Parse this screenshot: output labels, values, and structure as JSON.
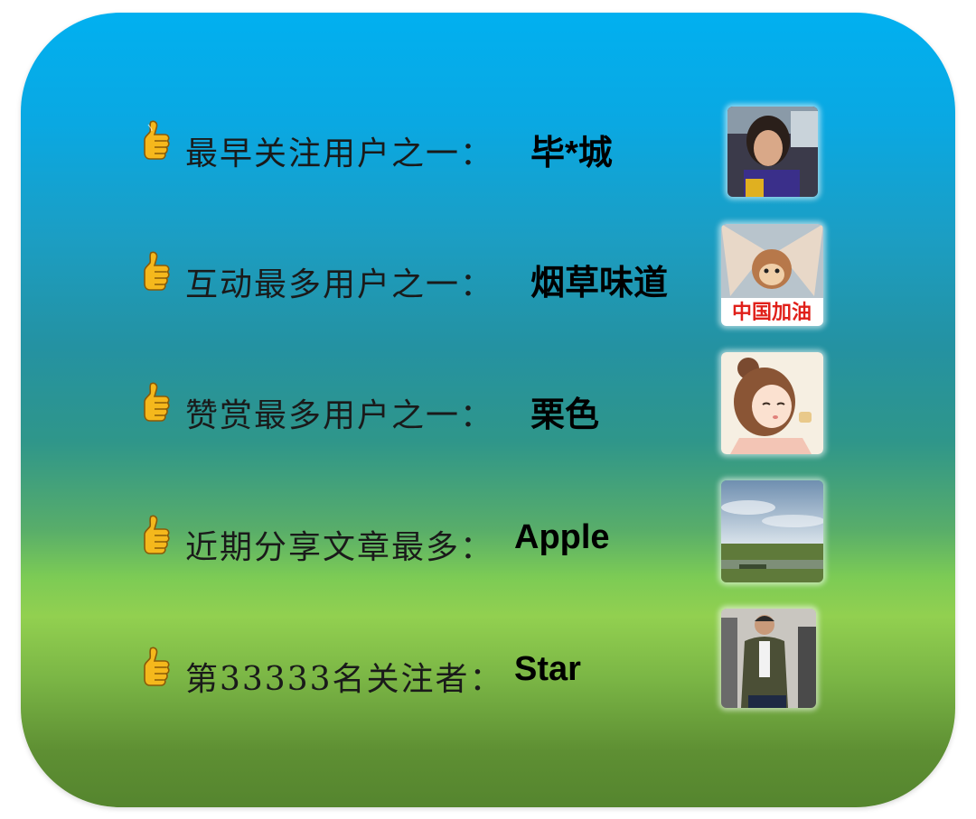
{
  "rows": [
    {
      "label": "最早关注用户之一：",
      "name": "毕*城",
      "avatar": "girl-photo-avatar"
    },
    {
      "label": "互动最多用户之一：",
      "name": "烟草味道",
      "avatar": "monkey-cartoon-avatar",
      "avatar_caption": "中国加油"
    },
    {
      "label": "赞赏最多用户之一：",
      "name": "栗色",
      "avatar": "anime-girl-avatar"
    },
    {
      "label": "近期分享文章最多：",
      "name": "Apple",
      "avatar": "landscape-photo-avatar"
    },
    {
      "label": "第33333名关注者：",
      "name": "Star",
      "avatar": "man-street-photo-avatar"
    }
  ],
  "icons": {
    "bullet": "thumbs-up-icon"
  },
  "colors": {
    "gradient_top": "#01b0f0",
    "gradient_mid": "#2f968a",
    "gradient_light_green": "#92d050",
    "gradient_bottom": "#55852e",
    "thumb_yellow": "#f5b81c",
    "text": "#1a1a1a"
  }
}
